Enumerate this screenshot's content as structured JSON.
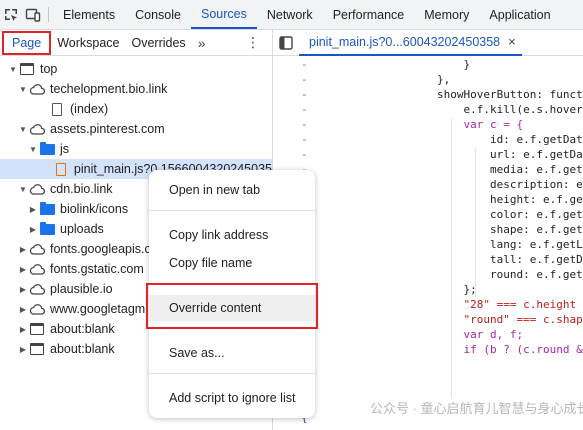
{
  "topbar": {
    "tabs": [
      "Elements",
      "Console",
      "Sources",
      "Network",
      "Performance",
      "Memory",
      "Application"
    ],
    "active": "Sources"
  },
  "navigator": {
    "tabs": [
      "Page",
      "Workspace",
      "Overrides"
    ],
    "active": "Page",
    "more": "»"
  },
  "editor": {
    "file_tab": "pinit_main.js?0...60043202450358",
    "close": "×"
  },
  "tree": [
    {
      "label": "top",
      "icon": "frame-icon",
      "level": 0,
      "expanded": true
    },
    {
      "label": "techelopment.bio.link",
      "icon": "cloud-icon",
      "level": 1,
      "expanded": true
    },
    {
      "label": "(index)",
      "icon": "file-icon",
      "level": 2
    },
    {
      "label": "assets.pinterest.com",
      "icon": "cloud-icon",
      "level": 1,
      "expanded": true
    },
    {
      "label": "js",
      "icon": "folder-icon",
      "level": 2,
      "expanded": true
    },
    {
      "label": "pinit_main.js?0.1566004320245035",
      "icon": "js-file-icon",
      "level": 3,
      "selected": true
    },
    {
      "label": "cdn.bio.link",
      "icon": "cloud-icon",
      "level": 1,
      "expanded": true
    },
    {
      "label": "biolink/icons",
      "icon": "folder-icon",
      "level": 2,
      "expanded": false
    },
    {
      "label": "uploads",
      "icon": "folder-icon",
      "level": 2,
      "expanded": false
    },
    {
      "label": "fonts.googleapis.com",
      "icon": "cloud-icon",
      "level": 1,
      "expanded": false
    },
    {
      "label": "fonts.gstatic.com",
      "icon": "cloud-icon",
      "level": 1,
      "expanded": false
    },
    {
      "label": "plausible.io",
      "icon": "cloud-icon",
      "level": 1,
      "expanded": false
    },
    {
      "label": "www.googletagm",
      "icon": "cloud-icon",
      "level": 1,
      "expanded": false
    },
    {
      "label": "about:blank",
      "icon": "frame-icon",
      "level": 1,
      "expanded": false
    },
    {
      "label": "about:blank",
      "icon": "frame-icon",
      "level": 1,
      "expanded": false
    }
  ],
  "context_menu": {
    "items": [
      "Open in new tab",
      "Copy link address",
      "Copy file name",
      "Override content",
      "Save as...",
      "Add script to ignore list"
    ],
    "highlighted": "Override content"
  },
  "code": {
    "gutter_marks": [
      "-",
      "-",
      "-",
      "-",
      "-",
      "-",
      "-",
      "-",
      "-",
      "-",
      "-",
      "-",
      "-",
      "-",
      "-",
      "-",
      "-",
      "-",
      "-",
      "-",
      "-",
      "-",
      "-",
      "{"
    ],
    "lines": [
      "    }",
      "},",
      "showHoverButton: funct",
      "    e.f.kill(e.s.hover",
      "    var c = {",
      "        id: e.f.getDat",
      "        url: e.f.getDa",
      "        media: e.f.get",
      "        description: e",
      "        height: e.f.ge",
      "        color: e.f.get",
      "        shape: e.f.get",
      "        lang: e.f.getL",
      "        tall: e.f.getD",
      "        round: e.f.get",
      "    };",
      "    \"28\" === c.height",
      "    \"round\" === c.shap",
      "    var d, f;",
      "    if (b ? (c.round &"
    ]
  },
  "watermark": "公众号 · 童心启航育儿智慧与身心成长"
}
